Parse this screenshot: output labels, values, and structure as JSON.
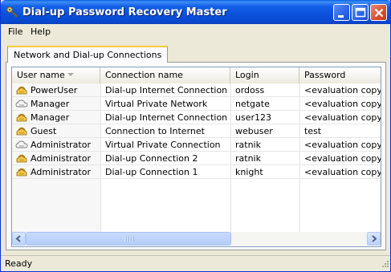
{
  "window": {
    "title": "Dial-up Password Recovery Master",
    "title_icon": "key-icon",
    "controls": [
      "minimize-icon",
      "maximize-icon",
      "close-icon"
    ]
  },
  "menu": {
    "items": [
      "File",
      "Help"
    ]
  },
  "tab": {
    "label": "Network and Dial-up Connections"
  },
  "table": {
    "columns": [
      "User name",
      "Connection name",
      "Login",
      "Password"
    ],
    "sort_column": "User name",
    "rows": [
      {
        "icon": "dialup-icon",
        "user": "PowerUser",
        "connection": "Dial-up Internet Connection",
        "login": "ordoss",
        "password": "<evaluation copy>"
      },
      {
        "icon": "vpn-icon",
        "user": "Manager",
        "connection": "Virtual Private Network",
        "login": "netgate",
        "password": "<evaluation copy>"
      },
      {
        "icon": "dialup-icon",
        "user": "Manager",
        "connection": "Dial-up Internet Connection",
        "login": "user123",
        "password": "<evaluation copy>"
      },
      {
        "icon": "dialup-icon",
        "user": "Guest",
        "connection": "Connection to Internet",
        "login": "webuser",
        "password": "test"
      },
      {
        "icon": "vpn-icon",
        "user": "Administrator",
        "connection": "Virtual Private Connection",
        "login": "ratnik",
        "password": "<evaluation copy>"
      },
      {
        "icon": "dialup-icon",
        "user": "Administrator",
        "connection": "Dial-up Connection 2",
        "login": "ratnik",
        "password": "<evaluation copy>"
      },
      {
        "icon": "dialup-icon",
        "user": "Administrator",
        "connection": "Dial-up Connection 1",
        "login": "knight",
        "password": "<evaluation copy>"
      }
    ]
  },
  "statusbar": {
    "text": "Ready"
  },
  "colors": {
    "titlebar": "#0b50dc",
    "tab_highlight": "#ffc83c",
    "close_button": "#d8502f"
  }
}
